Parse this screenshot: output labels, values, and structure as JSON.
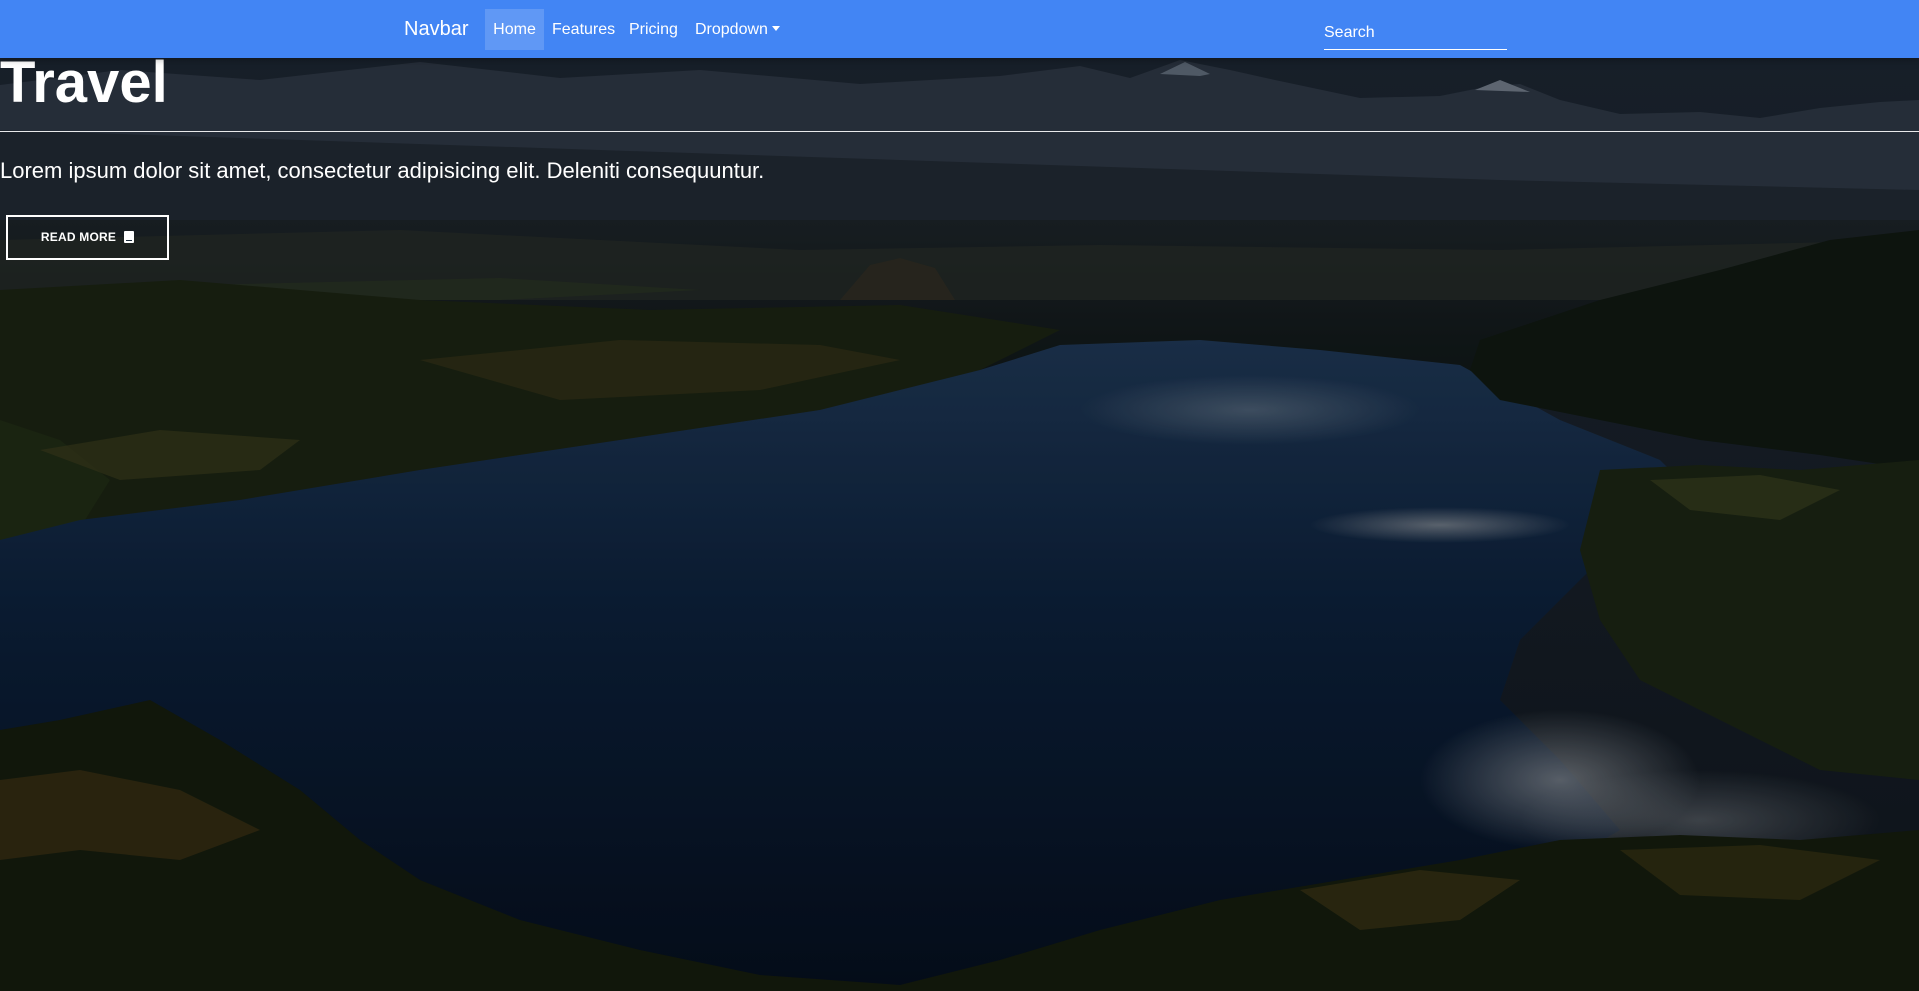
{
  "navbar": {
    "brand": "Navbar",
    "items": [
      {
        "label": "Home",
        "active": true
      },
      {
        "label": "Features",
        "active": false
      },
      {
        "label": "Pricing",
        "active": false
      },
      {
        "label": "Dropdown",
        "active": false,
        "has_caret": true
      }
    ],
    "search": {
      "placeholder": "Search",
      "value": ""
    },
    "bg_color": "#4285f4"
  },
  "hero": {
    "title": "Travel",
    "lead": "Lorem ipsum dolor sit amet, consectetur adipisicing elit. Deleniti consequuntur.",
    "button": {
      "label": "READ MORE",
      "icon": "book-icon"
    }
  }
}
